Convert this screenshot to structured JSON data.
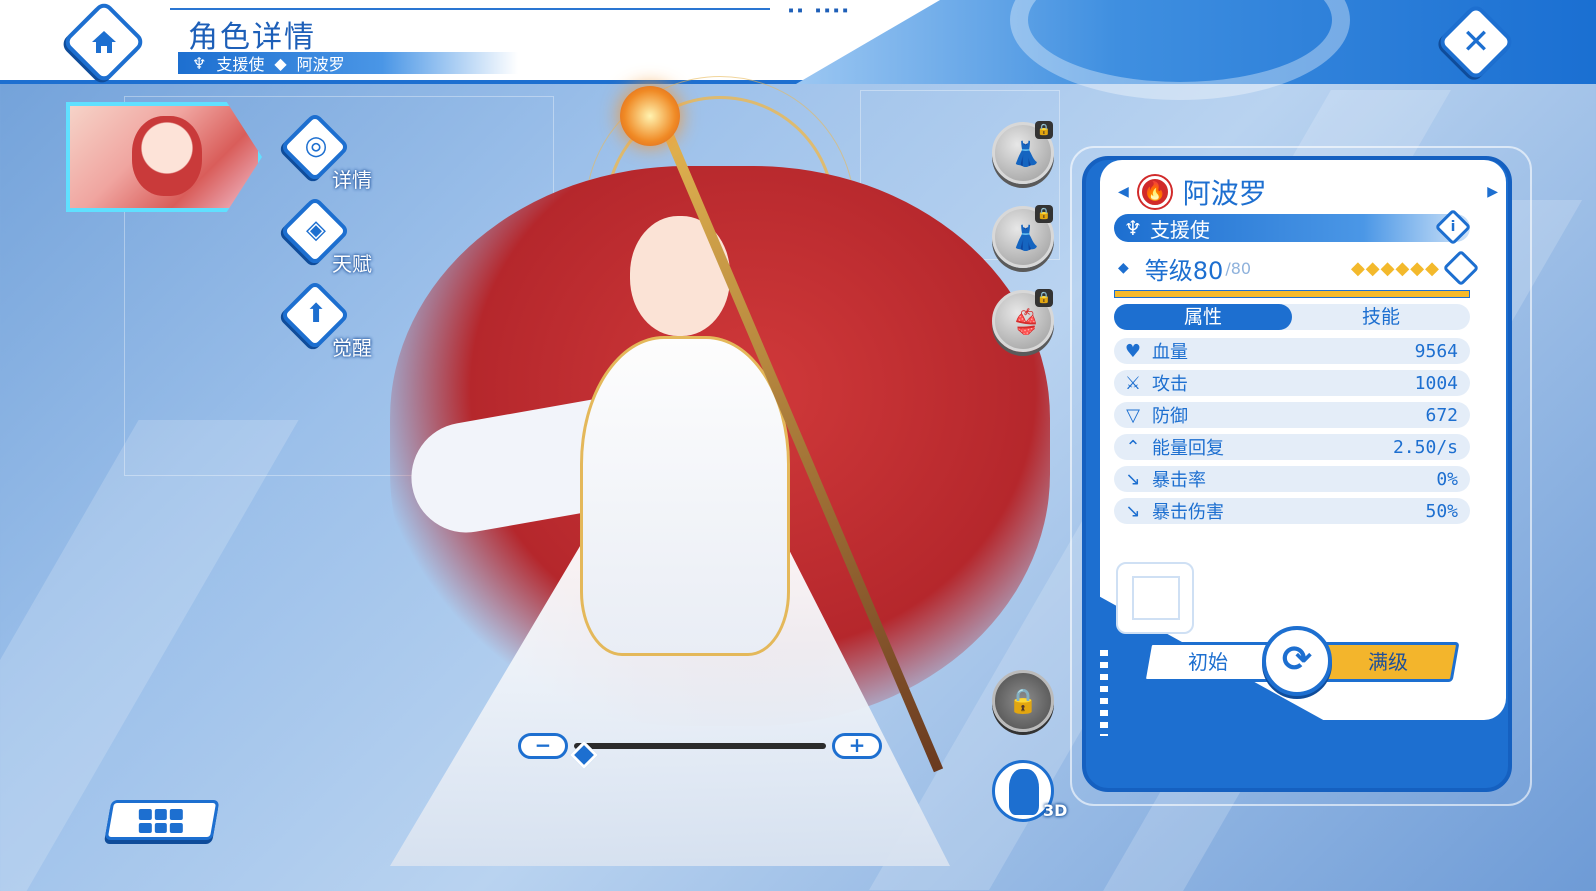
{
  "header": {
    "title": "角色详情",
    "role": "支援使",
    "character_name": "阿波罗"
  },
  "side_menu": {
    "items": [
      {
        "label": "详情",
        "icon": "target-icon"
      },
      {
        "label": "天赋",
        "icon": "talent-icon"
      },
      {
        "label": "觉醒",
        "icon": "awaken-arrow-icon"
      }
    ]
  },
  "panel": {
    "name": "阿波罗",
    "element_icon": "fire-icon",
    "role": "支援使",
    "level_label": "等级80",
    "level_max": "/80",
    "stars": "◆◆◆◆◆◆",
    "exp_fraction": 1.0,
    "tabs": [
      "属性",
      "技能"
    ],
    "active_tab": "属性",
    "stats": [
      {
        "name": "血量",
        "value": "9564",
        "icon": "heart-icon",
        "glyph": "♥"
      },
      {
        "name": "攻击",
        "value": "1004",
        "icon": "sword-icon",
        "glyph": "⚔"
      },
      {
        "name": "防御",
        "value": "672",
        "icon": "shield-icon",
        "glyph": "▽"
      },
      {
        "name": "能量回复",
        "value": "2.50/s",
        "icon": "energy-icon",
        "glyph": "⌃"
      },
      {
        "name": "暴击率",
        "value": "0%",
        "icon": "crit-rate-icon",
        "glyph": "↘"
      },
      {
        "name": "暴击伤害",
        "value": "50%",
        "icon": "crit-damage-icon",
        "glyph": "↘"
      }
    ],
    "toggle_left": "初始",
    "toggle_right": "满级"
  },
  "view_controls": {
    "zoom_minus": "−",
    "zoom_plus": "+",
    "zoom_level": 0.0,
    "label_3d": "3D"
  },
  "colors": {
    "primary": "#1d6fd0",
    "accent_gold": "#f3b52c",
    "element_fire": "#d12a2a"
  }
}
